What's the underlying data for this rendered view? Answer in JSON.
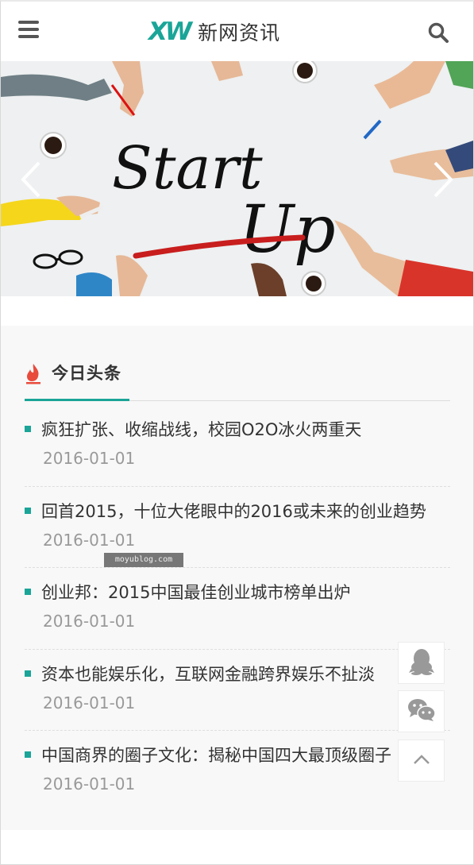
{
  "header": {
    "logo_mark": "XW",
    "logo_text": "新网资讯",
    "menu_icon": "hamburger-menu-icon",
    "search_icon": "search-icon"
  },
  "banner": {
    "image": "start-up-hands-illustration",
    "art_text_1": "Start",
    "art_text_2": "Up",
    "prev_icon": "chevron-left-icon",
    "next_icon": "chevron-right-icon"
  },
  "news": {
    "title": "今日头条",
    "title_icon": "fire-icon",
    "accent_color": "#1aa598",
    "items": [
      {
        "title": "疯狂扩张、收缩战线，校园O2O冰火两重天",
        "date": "2016-01-01"
      },
      {
        "title": "回首2015，十位大佬眼中的2016或未来的创业趋势",
        "date": "2016-01-01"
      },
      {
        "title": "创业邦：2015中国最佳创业城市榜单出炉",
        "date": "2016-01-01"
      },
      {
        "title": "资本也能娱乐化，互联网金融跨界娱乐不扯淡",
        "date": "2016-01-01"
      },
      {
        "title": "中国商界的圈子文化：揭秘中国四大最顶级圈子",
        "date": "2016-01-01"
      }
    ]
  },
  "watermark": "moyublog.com",
  "floating": {
    "qq_icon": "qq-penguin-icon",
    "wechat_icon": "wechat-icon",
    "top_icon": "chevron-up-icon"
  }
}
